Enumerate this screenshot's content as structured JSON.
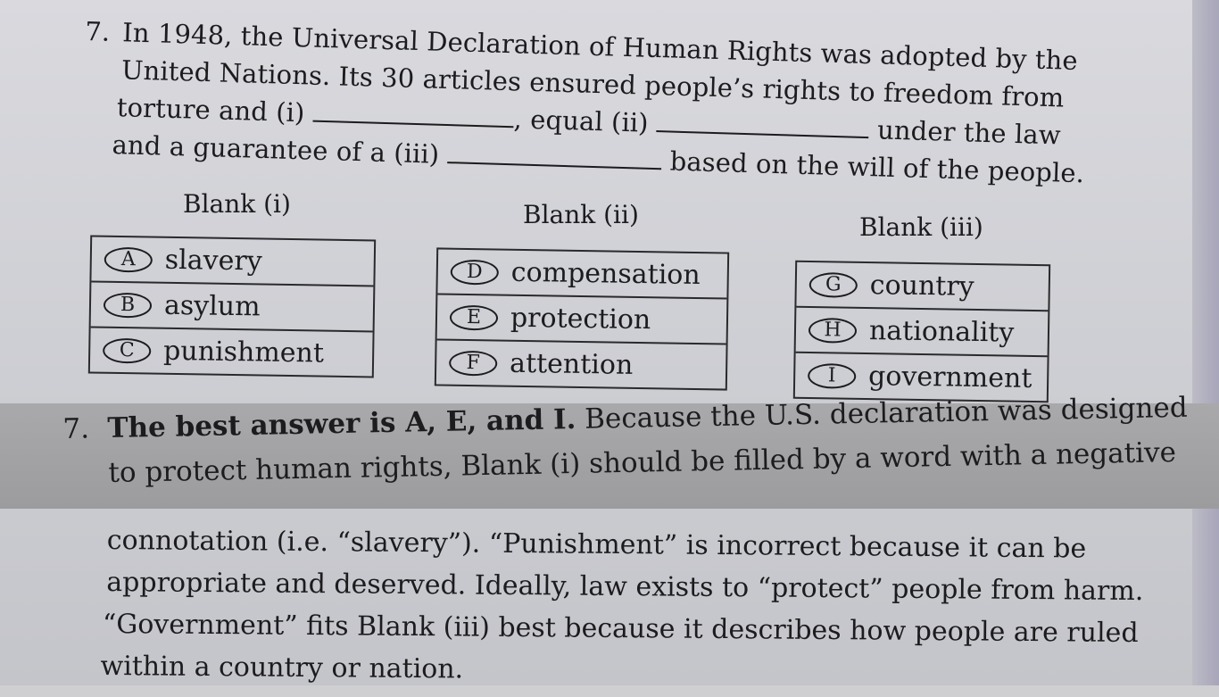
{
  "question": {
    "number": "7.",
    "line1": "In 1948, the Universal Declaration of Human Rights was adopted by the",
    "line2": "United Nations. Its 30 articles ensured people’s rights to freedom from",
    "line3a": "torture and (i)",
    "line3b": ", equal (ii)",
    "line3c": "under the law",
    "line4a": "and a guarantee of a (iii)",
    "line4b": "based on the will of the people."
  },
  "blanks": {
    "i": {
      "label": "Blank (i)",
      "options": [
        {
          "letter": "A",
          "word": "slavery"
        },
        {
          "letter": "B",
          "word": "asylum"
        },
        {
          "letter": "C",
          "word": "punishment"
        }
      ]
    },
    "ii": {
      "label": "Blank (ii)",
      "options": [
        {
          "letter": "D",
          "word": "compensation"
        },
        {
          "letter": "E",
          "word": "protection"
        },
        {
          "letter": "F",
          "word": "attention"
        }
      ]
    },
    "iii": {
      "label": "Blank (iii)",
      "options": [
        {
          "letter": "G",
          "word": "country"
        },
        {
          "letter": "H",
          "word": "nationality"
        },
        {
          "letter": "I",
          "word": "government"
        }
      ]
    }
  },
  "answer": {
    "number": "7.",
    "bold": "The best answer is A, E, and I.",
    "rest1": "Because the U.S. declaration was designed",
    "line2": "to protect human rights, Blank (i) should be filled by a word with a negative"
  },
  "explanation": {
    "line1": "connotation (i.e. “slavery”). “Punishment” is incorrect because it can be",
    "line2": "appropriate and deserved. Ideally, law exists to “protect” people from harm.",
    "line3": "“Government” fits Blank (iii) best because it describes how people are ruled",
    "line4": "within a country or nation."
  }
}
